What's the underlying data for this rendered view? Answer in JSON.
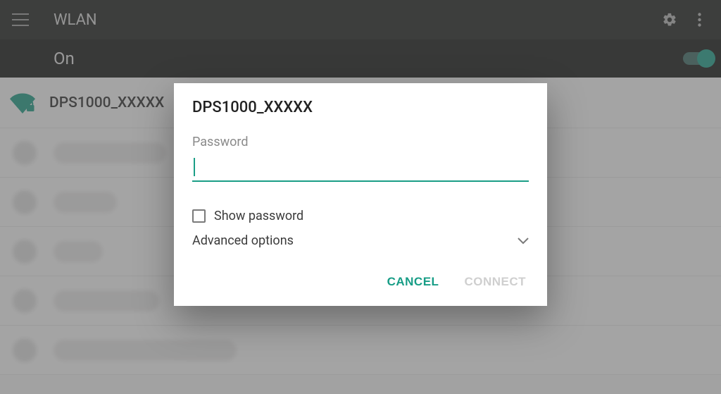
{
  "appbar": {
    "title": "WLAN"
  },
  "toggle": {
    "label": "On",
    "state": true
  },
  "list": {
    "network_0": "DPS1000_XXXXX"
  },
  "dialog": {
    "title": "DPS1000_XXXXX",
    "password_label": "Password",
    "password_value": "",
    "show_password_label": "Show password",
    "show_password_checked": false,
    "advanced_label": "Advanced options",
    "cancel": "CANCEL",
    "connect": "CONNECT"
  },
  "colors": {
    "accent": "#179d86",
    "appbar_bg": "#1c1d1c"
  }
}
